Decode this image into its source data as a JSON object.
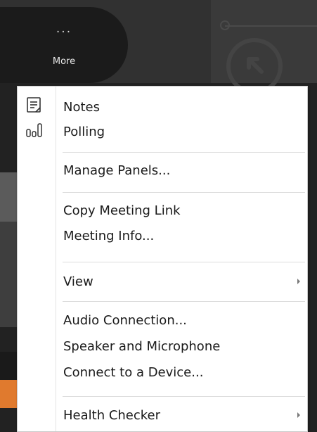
{
  "toolbar": {
    "more_dots": "···",
    "more_label": "More"
  },
  "menu": {
    "items": [
      {
        "label": "Notes",
        "icon": "notes-icon"
      },
      {
        "label": "Polling",
        "icon": "polling-icon"
      },
      {
        "label": "Manage Panels..."
      },
      {
        "label": "Copy Meeting Link"
      },
      {
        "label": "Meeting Info..."
      },
      {
        "label": "View",
        "has_submenu": true
      },
      {
        "label": "Audio Connection..."
      },
      {
        "label": "Speaker and Microphone"
      },
      {
        "label": "Connect to a Device..."
      },
      {
        "label": "Health Checker",
        "has_submenu": true
      }
    ]
  },
  "colors": {
    "toolbar_bg": "#313131",
    "more_button_bg": "#1b1b1b",
    "menu_bg": "#ffffff",
    "menu_text": "#1a1a1a",
    "separator": "#dcdcdc"
  }
}
